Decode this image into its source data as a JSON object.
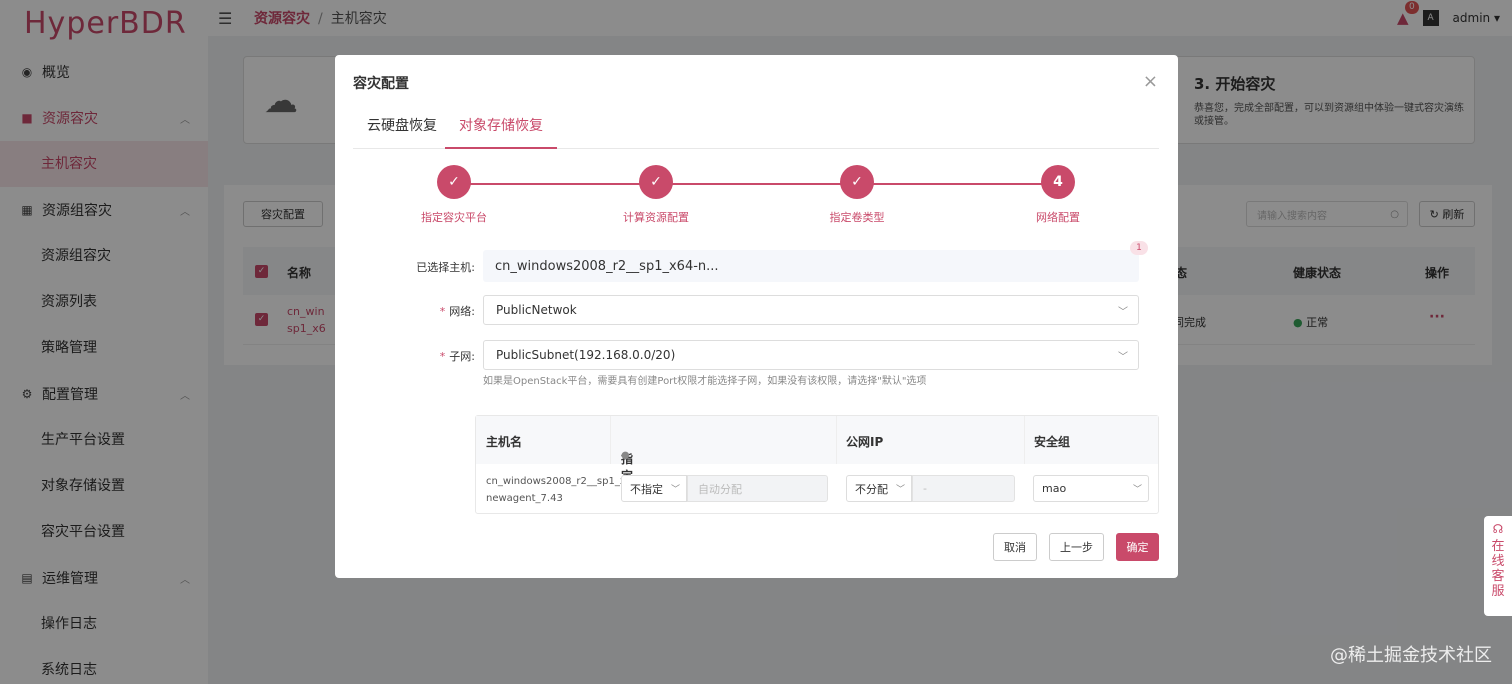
{
  "app": {
    "logo": "HyperBDR"
  },
  "sidebar": {
    "groups": [
      {
        "label": "概览",
        "icon": "dashboard-icon"
      },
      {
        "label": "资源容灾",
        "icon": "shield-icon",
        "items": [
          "主机容灾"
        ]
      },
      {
        "label": "资源组容灾",
        "icon": "grid-icon",
        "items": [
          "资源组容灾",
          "资源列表",
          "策略管理"
        ]
      },
      {
        "label": "配置管理",
        "icon": "settings-icon",
        "items": [
          "生产平台设置",
          "对象存储设置",
          "容灾平台设置"
        ]
      },
      {
        "label": "运维管理",
        "icon": "document-icon",
        "items": [
          "操作日志",
          "系统日志"
        ]
      }
    ]
  },
  "header": {
    "breadcrumb": [
      "资源容灾",
      "主机容灾"
    ],
    "notification_count": "0",
    "user": "admin"
  },
  "background": {
    "step3_title": "3. 开始容灾",
    "step3_desc": "恭喜您，完成全部配置，可以到资源组中体验一键式容灾演练或接管。",
    "config_button": "容灾配置",
    "search_placeholder": "请输入搜索内容",
    "refresh_button": "刷新",
    "columns": {
      "name": "名称",
      "status": "状态",
      "health": "健康状态",
      "action": "操作"
    },
    "row": {
      "name_line1": "cn_win",
      "name_line2": "sp1_x6",
      "status": "同完成",
      "health": "正常",
      "action": "···"
    }
  },
  "dialog": {
    "title": "容灾配置",
    "tabs": [
      "云硬盘恢复",
      "对象存储恢复"
    ],
    "active_tab": 1,
    "steps": [
      {
        "label": "指定容灾平台",
        "state": "done"
      },
      {
        "label": "计算资源配置",
        "state": "done"
      },
      {
        "label": "指定卷类型",
        "state": "done"
      },
      {
        "label": "网络配置",
        "state": "current",
        "number": "4"
      }
    ],
    "form": {
      "host_label": "已选择主机:",
      "host_value": "cn_windows2008_r2__sp1_x64-n...",
      "host_count": "1",
      "network_label": "网络:",
      "network_value": "PublicNetwok",
      "subnet_label": "子网:",
      "subnet_value": "PublicSubnet(192.168.0.0/20)",
      "subnet_hint": "如果是OpenStack平台，需要具有创建Port权限才能选择子网，如果没有该权限，请选择\"默认\"选项"
    },
    "table": {
      "columns": [
        "主机名",
        "指定IP",
        "公网IP",
        "安全组"
      ],
      "row": {
        "hostname": "cn_windows2008_r2__sp1_x64-newagent_7.43",
        "ip_mode": "不指定",
        "ip_placeholder": "自动分配",
        "public_ip_mode": "不分配",
        "public_ip_placeholder": "-",
        "security_group": "mao"
      }
    },
    "buttons": {
      "cancel": "取消",
      "prev": "上一步",
      "confirm": "确定"
    }
  },
  "service": {
    "label": "在线客服"
  },
  "watermark": "@稀土掘金技术社区",
  "colors": {
    "accent": "#c94a6a"
  }
}
